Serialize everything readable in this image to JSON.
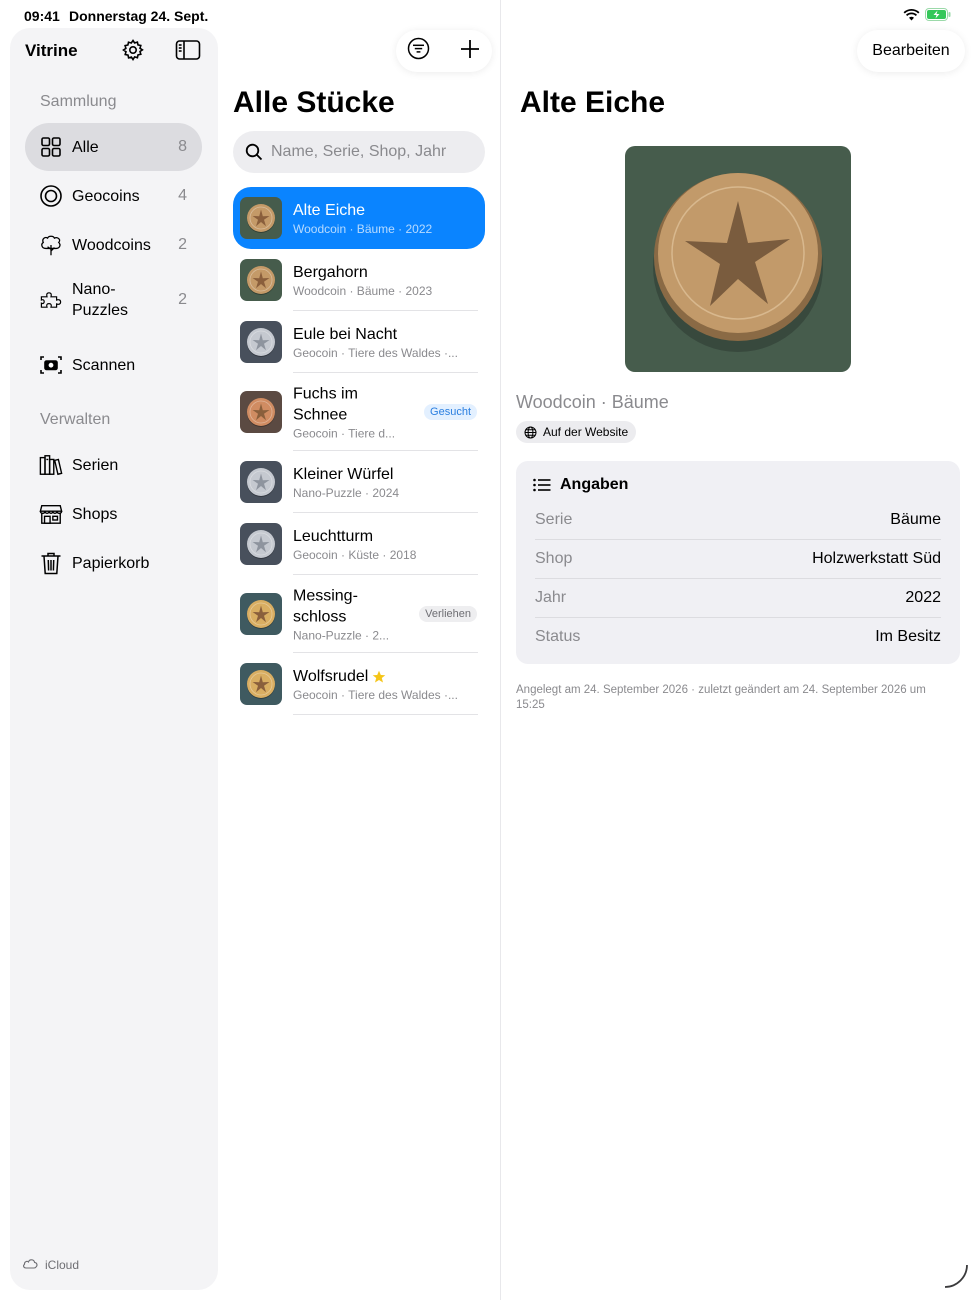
{
  "status_bar": {
    "time": "09:41",
    "date": "Donnerstag 24. Sept."
  },
  "sidebar": {
    "app_title": "Vitrine",
    "section_collection": "Sammlung",
    "section_manage": "Verwalten",
    "collection_items": [
      {
        "label": "Alle",
        "count": "8",
        "icon": "grid-icon"
      },
      {
        "label": "Geocoins",
        "count": "4",
        "icon": "target-circle-icon"
      },
      {
        "label": "Woodcoins",
        "count": "2",
        "icon": "tree-icon"
      },
      {
        "label": "Nano-\nPuzzles",
        "count": "2",
        "icon": "puzzle-icon"
      },
      {
        "label": "Scannen",
        "count": "",
        "icon": "camera-scan-icon"
      }
    ],
    "manage_items": [
      {
        "label": "Serien",
        "icon": "books-icon"
      },
      {
        "label": "Shops",
        "icon": "storefront-icon"
      },
      {
        "label": "Papierkorb",
        "icon": "trash-icon"
      }
    ],
    "footer": "iCloud"
  },
  "list": {
    "title": "Alle Stücke",
    "search_placeholder": "Name, Serie, Shop, Jahr",
    "items": [
      {
        "title": "Alte Eiche",
        "subtitle": "Woodcoin · Bäume · 2022",
        "badge": "",
        "coin": "#c49a68",
        "bg": "#465c4c"
      },
      {
        "title": "Bergahorn",
        "subtitle": "Woodcoin · Bäume · 2023",
        "badge": "",
        "coin": "#c49a68",
        "bg": "#465c4c"
      },
      {
        "title": "Eule bei Nacht",
        "subtitle": "Geocoin · Tiere des Waldes ·...",
        "badge": "",
        "coin": "#c5c9d0",
        "bg": "#48505c"
      },
      {
        "title": "Fuchs im\nSchnee",
        "subtitle": "Geocoin · Tiere d...",
        "badge": "Gesucht",
        "coin": "#d08c62",
        "bg": "#5b4a42"
      },
      {
        "title": "Kleiner Würfel",
        "subtitle": "Nano-Puzzle · 2024",
        "badge": "",
        "coin": "#c5c9d0",
        "bg": "#48505c"
      },
      {
        "title": "Leuchtturm",
        "subtitle": "Geocoin · Küste · 2018",
        "badge": "",
        "coin": "#c5c9d0",
        "bg": "#48505c"
      },
      {
        "title": "Messing-\nschloss",
        "subtitle": "Nano-Puzzle · 2...",
        "badge": "Verliehen",
        "coin": "#d9ae62",
        "bg": "#3f5a60"
      },
      {
        "title": "Wolfsrudel",
        "subtitle": "Geocoin · Tiere des Waldes ·...",
        "badge": "",
        "coin": "#d9ae62",
        "bg": "#3f5a60",
        "starred": true
      }
    ]
  },
  "detail": {
    "edit_label": "Bearbeiten",
    "title": "Alte Eiche",
    "subtitle": "Woodcoin · Bäume",
    "website_chip": "Auf der Website",
    "card_title": "Angaben",
    "fields": [
      {
        "key": "Serie",
        "value": "Bäume"
      },
      {
        "key": "Shop",
        "value": "Holzwerkstatt Süd"
      },
      {
        "key": "Jahr",
        "value": "2022"
      },
      {
        "key": "Status",
        "value": "Im Besitz"
      }
    ],
    "meta": "Angelegt am 24. September 2026 · zuletzt geändert am 24. September 2026 um 15:25"
  },
  "colors": {
    "accent": "#0a84ff",
    "star": "#f5c518",
    "battery": "#34c759"
  }
}
